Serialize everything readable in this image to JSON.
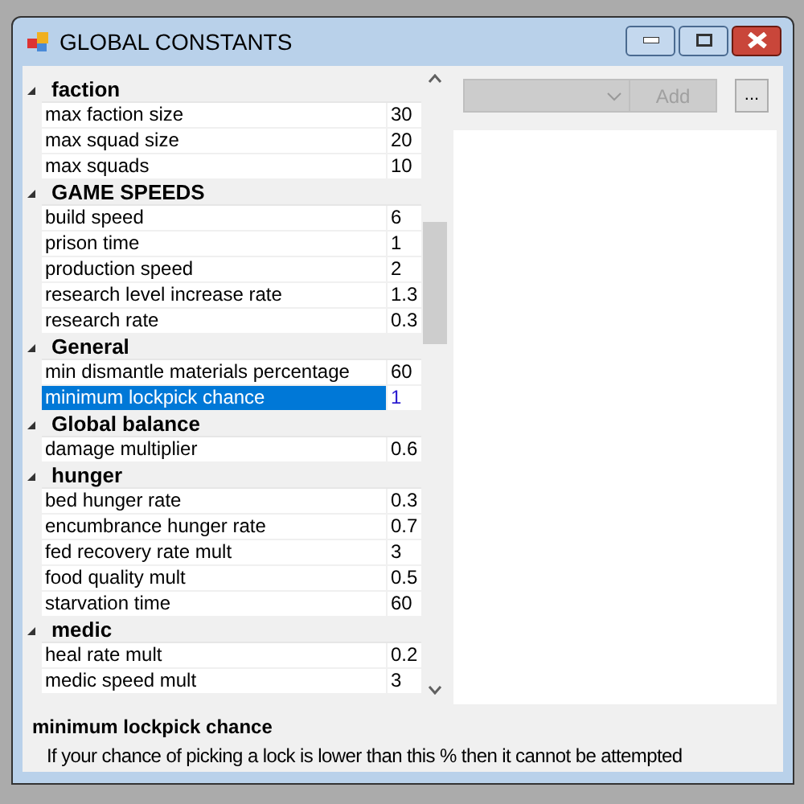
{
  "window": {
    "title": "GLOBAL CONSTANTS"
  },
  "grid": [
    {
      "kind": "category",
      "label": "faction",
      "expanded": true
    },
    {
      "kind": "property",
      "label": "max faction size",
      "value": "30",
      "selected": false
    },
    {
      "kind": "property",
      "label": "max squad size",
      "value": "20",
      "selected": false
    },
    {
      "kind": "property",
      "label": "max squads",
      "value": "10",
      "selected": false
    },
    {
      "kind": "category",
      "label": "GAME SPEEDS",
      "expanded": true
    },
    {
      "kind": "property",
      "label": "build speed",
      "value": "6",
      "selected": false
    },
    {
      "kind": "property",
      "label": "prison time",
      "value": "1",
      "selected": false
    },
    {
      "kind": "property",
      "label": "production speed",
      "value": "2",
      "selected": false
    },
    {
      "kind": "property",
      "label": "research level increase rate",
      "value": "1.3",
      "selected": false
    },
    {
      "kind": "property",
      "label": "research rate",
      "value": "0.3",
      "selected": false
    },
    {
      "kind": "category",
      "label": "General",
      "expanded": true
    },
    {
      "kind": "property",
      "label": "min dismantle materials percentage",
      "value": "60",
      "selected": false
    },
    {
      "kind": "property",
      "label": "minimum lockpick chance",
      "value": "1",
      "selected": true
    },
    {
      "kind": "category",
      "label": "Global balance",
      "expanded": true
    },
    {
      "kind": "property",
      "label": "damage multiplier",
      "value": "0.6",
      "selected": false
    },
    {
      "kind": "category",
      "label": "hunger",
      "expanded": true
    },
    {
      "kind": "property",
      "label": "bed hunger rate",
      "value": "0.3",
      "selected": false
    },
    {
      "kind": "property",
      "label": "encumbrance hunger rate",
      "value": "0.7",
      "selected": false
    },
    {
      "kind": "property",
      "label": "fed recovery rate mult",
      "value": "3",
      "selected": false
    },
    {
      "kind": "property",
      "label": "food quality mult",
      "value": "0.5",
      "selected": false
    },
    {
      "kind": "property",
      "label": "starvation time",
      "value": "60",
      "selected": false
    },
    {
      "kind": "category",
      "label": "medic",
      "expanded": true
    },
    {
      "kind": "property",
      "label": "heal rate mult",
      "value": "0.2",
      "selected": false
    },
    {
      "kind": "property",
      "label": "medic speed mult",
      "value": "3",
      "selected": false
    }
  ],
  "toolbar": {
    "add_button": "Add",
    "add_disabled": true,
    "more_button": "..."
  },
  "description": {
    "title": "minimum lockpick chance",
    "text": "If your chance of picking a lock is lower than this % then it cannot be attempted"
  }
}
